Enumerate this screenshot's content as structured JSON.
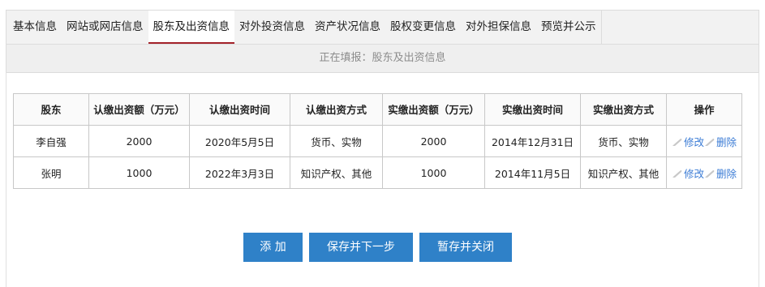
{
  "tabs": [
    {
      "label": "基本信息",
      "active": false
    },
    {
      "label": "网站或网店信息",
      "active": false
    },
    {
      "label": "股东及出资信息",
      "active": true
    },
    {
      "label": "对外投资信息",
      "active": false
    },
    {
      "label": "资产状况信息",
      "active": false
    },
    {
      "label": "股权变更信息",
      "active": false
    },
    {
      "label": "对外担保信息",
      "active": false
    },
    {
      "label": "预览并公示",
      "active": false
    }
  ],
  "status_text": "正在填报：股东及出资信息",
  "table": {
    "headers": [
      "股东",
      "认缴出资额（万元）",
      "认缴出资时间",
      "认缴出资方式",
      "实缴出资额（万元）",
      "实缴出资时间",
      "实缴出资方式",
      "操作"
    ],
    "rows": [
      [
        "李自强",
        "2000",
        "2020年5月5日",
        "货币、实物",
        "2000",
        "2014年12月31日",
        "货币、实物"
      ],
      [
        "张明",
        "1000",
        "2022年3月3日",
        "知识产权、其他",
        "1000",
        "2014年11月5日",
        "知识产权、其他"
      ]
    ],
    "edit_label": "修改",
    "delete_label": "删除"
  },
  "buttons": {
    "add": "添 加",
    "save_next": "保存并下一步",
    "save_close": "暂存并关闭"
  },
  "colors": {
    "accent_red": "#a3232b",
    "button_blue": "#2f81c8",
    "link_blue": "#3a7bd5"
  }
}
